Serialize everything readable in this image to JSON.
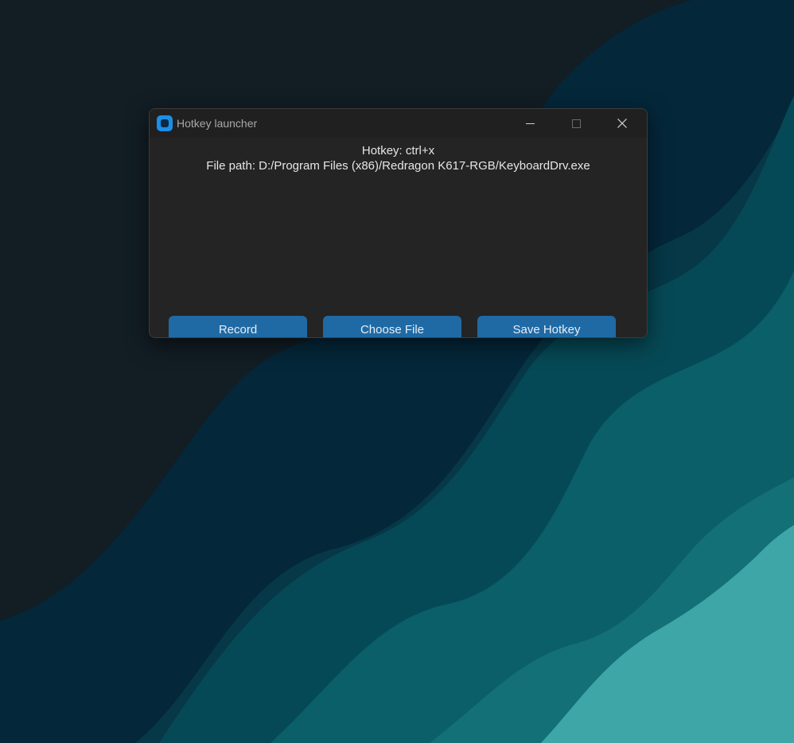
{
  "window": {
    "title": "Hotkey launcher",
    "icon": "app-icon",
    "controls": [
      "minimize-icon",
      "maximize-icon",
      "close-icon"
    ]
  },
  "content": {
    "hotkey_text": "Hotkey: ctrl+x",
    "file_path_text": "File path: D:/Program Files (x86)/Redragon K617-RGB/KeyboardDrv.exe"
  },
  "buttons": {
    "record": "Record",
    "choose_file": "Choose File",
    "save_hotkey": "Save Hotkey"
  },
  "colors": {
    "button": "#1f6aa5",
    "window_bg": "#242424",
    "titlebar_bg": "#202020",
    "app_icon": "#1b8fe6",
    "wallpaper_dark": "#121d24",
    "wallpaper_teal": "#3ea6a6"
  }
}
